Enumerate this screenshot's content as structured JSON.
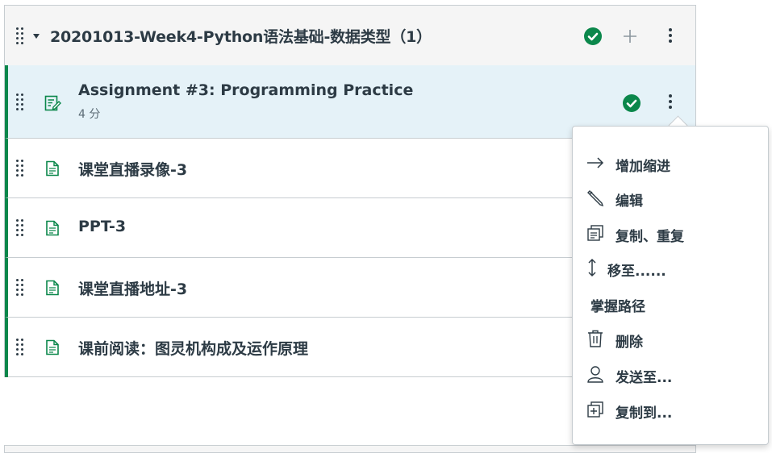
{
  "module": {
    "title": "20201013-Week4-Python语法基础-数据类型（1）",
    "status_icon": "check-circle-icon",
    "add_icon": "plus-icon",
    "options_icon": "kebab-icon"
  },
  "items": [
    {
      "title": "Assignment #3: Programming Practice",
      "subtitle": "4 分",
      "icon": "assignment-icon",
      "selected": true
    },
    {
      "title": "课堂直播录像-3",
      "icon": "page-icon"
    },
    {
      "title": "PPT-3",
      "icon": "page-icon"
    },
    {
      "title": "课堂直播地址-3",
      "icon": "page-icon"
    },
    {
      "title": "课前阅读：图灵机构成及运作原理",
      "icon": "page-icon"
    }
  ],
  "menu": {
    "items": [
      {
        "label": "增加缩进",
        "icon": "arrow-right-icon"
      },
      {
        "label": "编辑",
        "icon": "pencil-icon"
      },
      {
        "label": "复制、重复",
        "icon": "duplicate-icon"
      },
      {
        "label": "移至......",
        "icon": "move-icon"
      },
      {
        "label": "掌握路径",
        "icon": ""
      },
      {
        "label": "删除",
        "icon": "trash-icon"
      },
      {
        "label": "发送至...",
        "icon": "user-icon"
      },
      {
        "label": "复制到...",
        "icon": "copy-to-icon"
      }
    ]
  },
  "colors": {
    "accent_green": "#0b874b",
    "selected_bg": "#e5f2f8",
    "text": "#2d3b45"
  }
}
